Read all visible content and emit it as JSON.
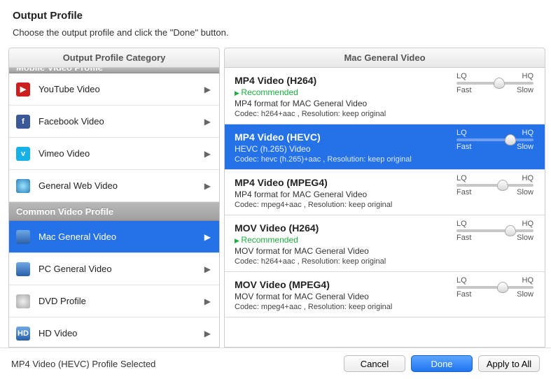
{
  "header": {
    "title": "Output Profile",
    "subtitle": "Choose the output profile and click the \"Done\" button."
  },
  "left": {
    "header": "Output Profile Category",
    "sections": [
      {
        "label": "Mobile Video Profile",
        "cutoff": true
      },
      {
        "items": [
          {
            "name": "youtube",
            "label": "YouTube Video",
            "iconClass": "ic-youtube",
            "iconText": "▶"
          },
          {
            "name": "facebook",
            "label": "Facebook Video",
            "iconClass": "ic-fb",
            "iconText": "f"
          },
          {
            "name": "vimeo",
            "label": "Vimeo Video",
            "iconClass": "ic-vimeo",
            "iconText": "v"
          },
          {
            "name": "general-web",
            "label": "General Web Video",
            "iconClass": "ic-web",
            "iconText": ""
          }
        ]
      },
      {
        "label": "Common Video Profile"
      },
      {
        "items": [
          {
            "name": "mac-general",
            "label": "Mac General Video",
            "iconClass": "ic-mac",
            "iconText": "",
            "selected": true
          },
          {
            "name": "pc-general",
            "label": "PC General Video",
            "iconClass": "ic-pc",
            "iconText": ""
          },
          {
            "name": "dvd",
            "label": "DVD Profile",
            "iconClass": "ic-dvd",
            "iconText": ""
          },
          {
            "name": "hd",
            "label": "HD Video",
            "iconClass": "ic-hd",
            "iconText": "HD"
          }
        ]
      }
    ]
  },
  "right": {
    "header": "Mac General Video",
    "slider_labels": {
      "lq": "LQ",
      "hq": "HQ",
      "fast": "Fast",
      "slow": "Slow"
    },
    "profiles": [
      {
        "name": "mp4-h264",
        "title": "MP4 Video (H264)",
        "recommended": "Recommended",
        "desc": "MP4 format for MAC General Video",
        "codec": "Codec: h264+aac , Resolution: keep original",
        "knob": 55
      },
      {
        "name": "mp4-hevc",
        "title": "MP4 Video (HEVC)",
        "selected": true,
        "desc": "HEVC (h.265) Video",
        "codec": "Codec: hevc (h.265)+aac , Resolution: keep original",
        "knob": 70
      },
      {
        "name": "mp4-mpeg4",
        "title": "MP4 Video (MPEG4)",
        "desc": "MP4 format for MAC General Video",
        "codec": "Codec: mpeg4+aac , Resolution: keep original",
        "knob": 60
      },
      {
        "name": "mov-h264",
        "title": "MOV Video (H264)",
        "recommended": "Recommended",
        "desc": "MOV format for MAC General Video",
        "codec": "Codec: h264+aac , Resolution: keep original",
        "knob": 70
      },
      {
        "name": "mov-mpeg4",
        "title": "MOV Video (MPEG4)",
        "desc": "MOV format for MAC General Video",
        "codec": "Codec: mpeg4+aac , Resolution: keep original",
        "knob": 60
      }
    ]
  },
  "footer": {
    "status": "MP4 Video (HEVC) Profile Selected",
    "cancel": "Cancel",
    "done": "Done",
    "apply_all": "Apply to All"
  }
}
